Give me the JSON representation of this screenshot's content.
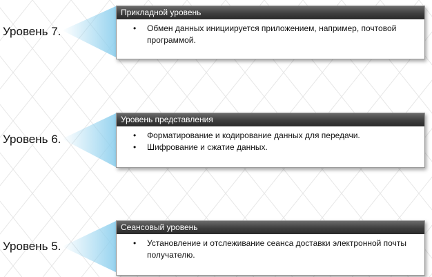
{
  "colors": {
    "header_top": "#6a6a6a",
    "header_bottom": "#2a2a2a",
    "beam": "#8fd0ee",
    "grid_line": "#e6e6e6"
  },
  "bullet_symbol": "•",
  "layers": [
    {
      "label": "Уровень 7.",
      "title": "Прикладной уровень",
      "bullets": [
        "Обмен данных инициируется приложением, например, почтовой программой."
      ]
    },
    {
      "label": "Уровень 6.",
      "title": "Уровень представления",
      "bullets": [
        "Форматирование и кодирование данных для передачи.",
        "Шифрование и сжатие данных."
      ]
    },
    {
      "label": "Уровень 5.",
      "title": "Сеансовый уровень",
      "bullets": [
        "Установление и отслеживание сеанса доставки электронной почты получателю."
      ]
    }
  ]
}
